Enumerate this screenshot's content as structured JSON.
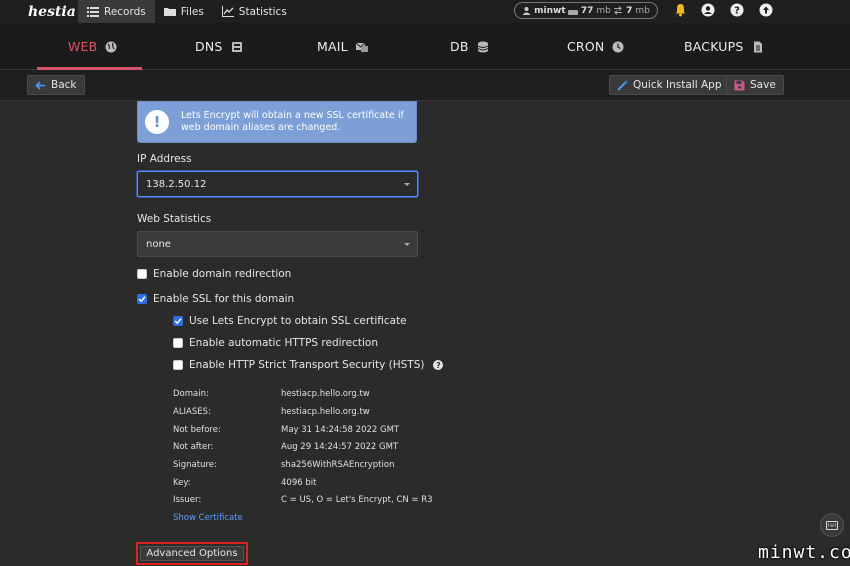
{
  "app": {
    "logo": "hestia"
  },
  "topnav": [
    {
      "label": "Records",
      "icon": "list-icon"
    },
    {
      "label": "Files",
      "icon": "folder-icon"
    },
    {
      "label": "Statistics",
      "icon": "chart-icon"
    }
  ],
  "usage": {
    "user": "minwt",
    "disk": "77",
    "disk_unit": "mb",
    "bandwidth": "7",
    "bandwidth_unit": "mb"
  },
  "tabs": [
    {
      "label": "WEB",
      "icon": "globe-icon",
      "active": true
    },
    {
      "label": "DNS",
      "icon": "dns-icon"
    },
    {
      "label": "MAIL",
      "icon": "mail-icon"
    },
    {
      "label": "DB",
      "icon": "database-icon"
    },
    {
      "label": "CRON",
      "icon": "clock-icon"
    },
    {
      "label": "BACKUPS",
      "icon": "file-icon"
    }
  ],
  "toolbar": {
    "back": "Back",
    "quick_install": "Quick Install App",
    "save": "Save"
  },
  "alert": {
    "text": "Lets Encrypt will obtain a new SSL certificate if web domain aliases are changed."
  },
  "form": {
    "ip_label": "IP Address",
    "ip_value": "138.2.50.12",
    "stats_label": "Web Statistics",
    "stats_value": "none",
    "redirect_label": "Enable domain redirection",
    "ssl_label": "Enable SSL for this domain",
    "letsencrypt_label": "Use Lets Encrypt to obtain SSL certificate",
    "https_label": "Enable automatic HTTPS redirection",
    "hsts_label": "Enable HTTP Strict Transport Security (HSTS)"
  },
  "cert": [
    {
      "key": "Domain:",
      "value": "hestiacp.hello.org.tw"
    },
    {
      "key": "ALIASES:",
      "value": "hestiacp.hello.org.tw"
    },
    {
      "key": "Not before:",
      "value": "May 31 14:24:58 2022 GMT"
    },
    {
      "key": "Not after:",
      "value": "Aug 29 14:24:57 2022 GMT"
    },
    {
      "key": "Signature:",
      "value": "sha256WithRSAEncryption"
    },
    {
      "key": "Key:",
      "value": "4096 bit"
    },
    {
      "key": "Issuer:",
      "value": "C = US, O = Let's Encrypt, CN = R3"
    }
  ],
  "show_cert": "Show Certificate",
  "advanced": "Advanced Options",
  "watermark": "minwt.com",
  "colors": {
    "accent": "#d5546a",
    "info": "#7b9fd6",
    "check": "#2d6ee0"
  }
}
